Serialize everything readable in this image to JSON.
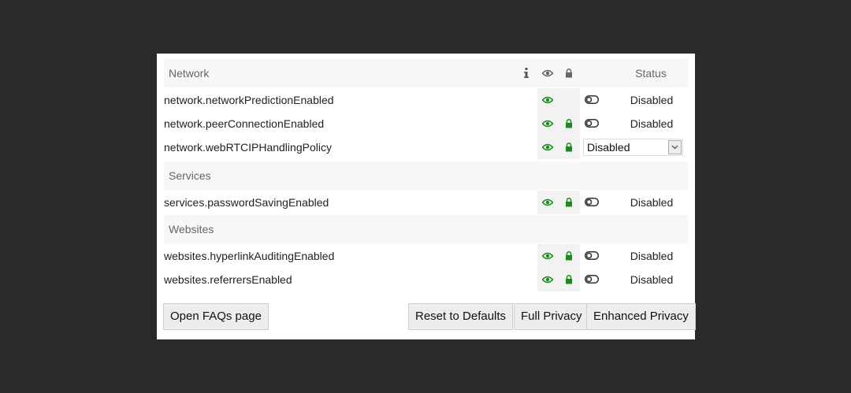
{
  "sections": [
    {
      "title": "Network",
      "rows": [
        {
          "name": "network.networkPredictionEnabled",
          "status": "Disabled"
        },
        {
          "name": "network.peerConnectionEnabled",
          "status": "Disabled"
        },
        {
          "name": "network.webRTCIPHandlingPolicy",
          "select_value": "Disabled"
        }
      ]
    },
    {
      "title": "Services",
      "rows": [
        {
          "name": "services.passwordSavingEnabled",
          "status": "Disabled"
        }
      ]
    },
    {
      "title": "Websites",
      "rows": [
        {
          "name": "websites.hyperlinkAuditingEnabled",
          "status": "Disabled"
        },
        {
          "name": "websites.referrersEnabled",
          "status": "Disabled"
        }
      ]
    }
  ],
  "columns": {
    "status": "Status",
    "info_icon": "info-icon",
    "visibility_icon": "eye-icon",
    "lock_icon": "lock-icon"
  },
  "buttons": {
    "faq": "Open FAQs page",
    "reset": "Reset to Defaults",
    "full_privacy": "Full Privacy",
    "enhanced_privacy": "Enhanced Privacy"
  },
  "colors": {
    "background": "#2a2a2a",
    "panel": "#ffffff",
    "header_bg": "#f7f7f7",
    "icon_col_bg": "#f2f2f2",
    "accent_green": "#1e8a1e"
  }
}
